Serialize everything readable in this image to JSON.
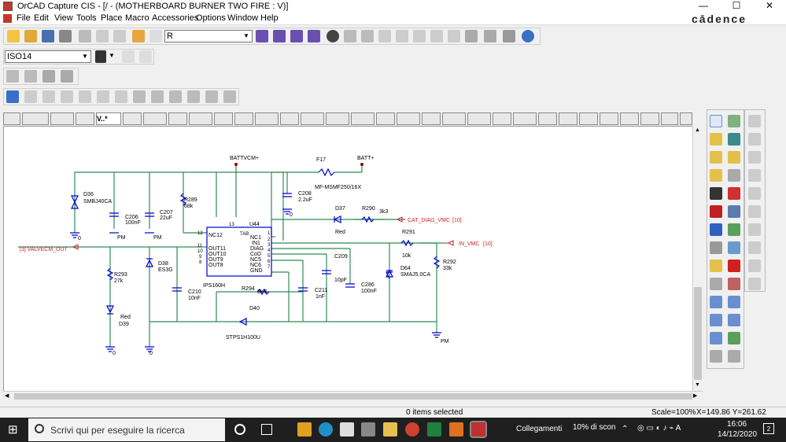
{
  "window": {
    "title": "OrCAD Capture CIS - [/ - (MOTHERBOARD BURNER TWO FIRE : V)]",
    "brand": "cādence"
  },
  "menu": [
    "File",
    "Edit",
    "View",
    "Tools",
    "Place",
    "Macro",
    "Accessories",
    "Options",
    "Window",
    "Help"
  ],
  "toolbar": {
    "search_value": "R",
    "part_combo_value": "ISO14"
  },
  "tabs": [
    "V..*"
  ],
  "schematic": {
    "labels": {
      "battvcm": "BATTVCM+",
      "batt": "BATT+",
      "f17": "F17",
      "fuse": "MF-MSMF250/16X",
      "c208": "C208",
      "c208v": "2.2uF",
      "gnd0": "0",
      "d36": "D36",
      "d36v": "SMBJ40CA",
      "c206": "C206",
      "c206v": "100nF",
      "c207": "C207",
      "c207v": "22uF",
      "r289": "R289",
      "r289v": "68k",
      "pm1": "PM",
      "pm2": "PM",
      "gnd1": "0",
      "u44": "U44",
      "tab": "TAB",
      "nc12": "NC12",
      "out11": "OUT11",
      "out10": "OUT10",
      "out9": "OUT9",
      "out8": "OUT8",
      "nc1": "NC1",
      "in1": "IN1",
      "diag": "DIAG",
      "cod": "CoD",
      "nc5": "NC5",
      "nc6": "NC6",
      "gnd": "GND",
      "p13": "13",
      "p12": "12",
      "p11": "11",
      "p10": "10",
      "p9": "9",
      "p8": "8",
      "p1": "1",
      "p2": "2",
      "p3": "3",
      "p4": "4",
      "p5": "5",
      "p6": "6",
      "p7": "7",
      "ips": "IPS160H",
      "d37": "D37",
      "red1": "Red",
      "r290": "R290",
      "r290v": "3k3",
      "cat": "CAT_DIAG_VMC",
      "cat_ref": "[10]",
      "r291": "R291",
      "r291v": "10k",
      "invmc": "IN_VMC",
      "invmc_ref": "[10]",
      "valve": "[3]  VALVECM_OUT",
      "d38": "D38",
      "d38v": "ES3G",
      "r293": "R293",
      "r293v": "27k",
      "c210": "C210",
      "c210v": "10nF",
      "r294": "R294",
      "r294v": "3K6",
      "d40": "D40",
      "d40v": "STPS1H100U",
      "c211": "C211",
      "c211v": "1nF",
      "c209": "C209",
      "c209v": "10pF",
      "c286": "C286",
      "c286v": "100nF",
      "d64": "D64",
      "d64v": "SMAJ5.0CA",
      "r292": "R292",
      "r292v": "33k",
      "pm3": "PM",
      "red2": "Red",
      "d39": "D39",
      "gnd2": "0",
      "gnd3": "0"
    }
  },
  "status": {
    "selected": "0 items selected",
    "scale": "Scale=100%",
    "coords": "X=149.86  Y=261.62"
  },
  "taskbar": {
    "search_placeholder": "Scrivi qui per eseguire la ricerca",
    "network": "Collegamenti",
    "weather": "10% di scon",
    "time": "16:06",
    "date": "14/12/2020"
  },
  "colors": {
    "wire": "#2e8b57",
    "part": "#0000cc",
    "netlabel": "#d02020"
  }
}
